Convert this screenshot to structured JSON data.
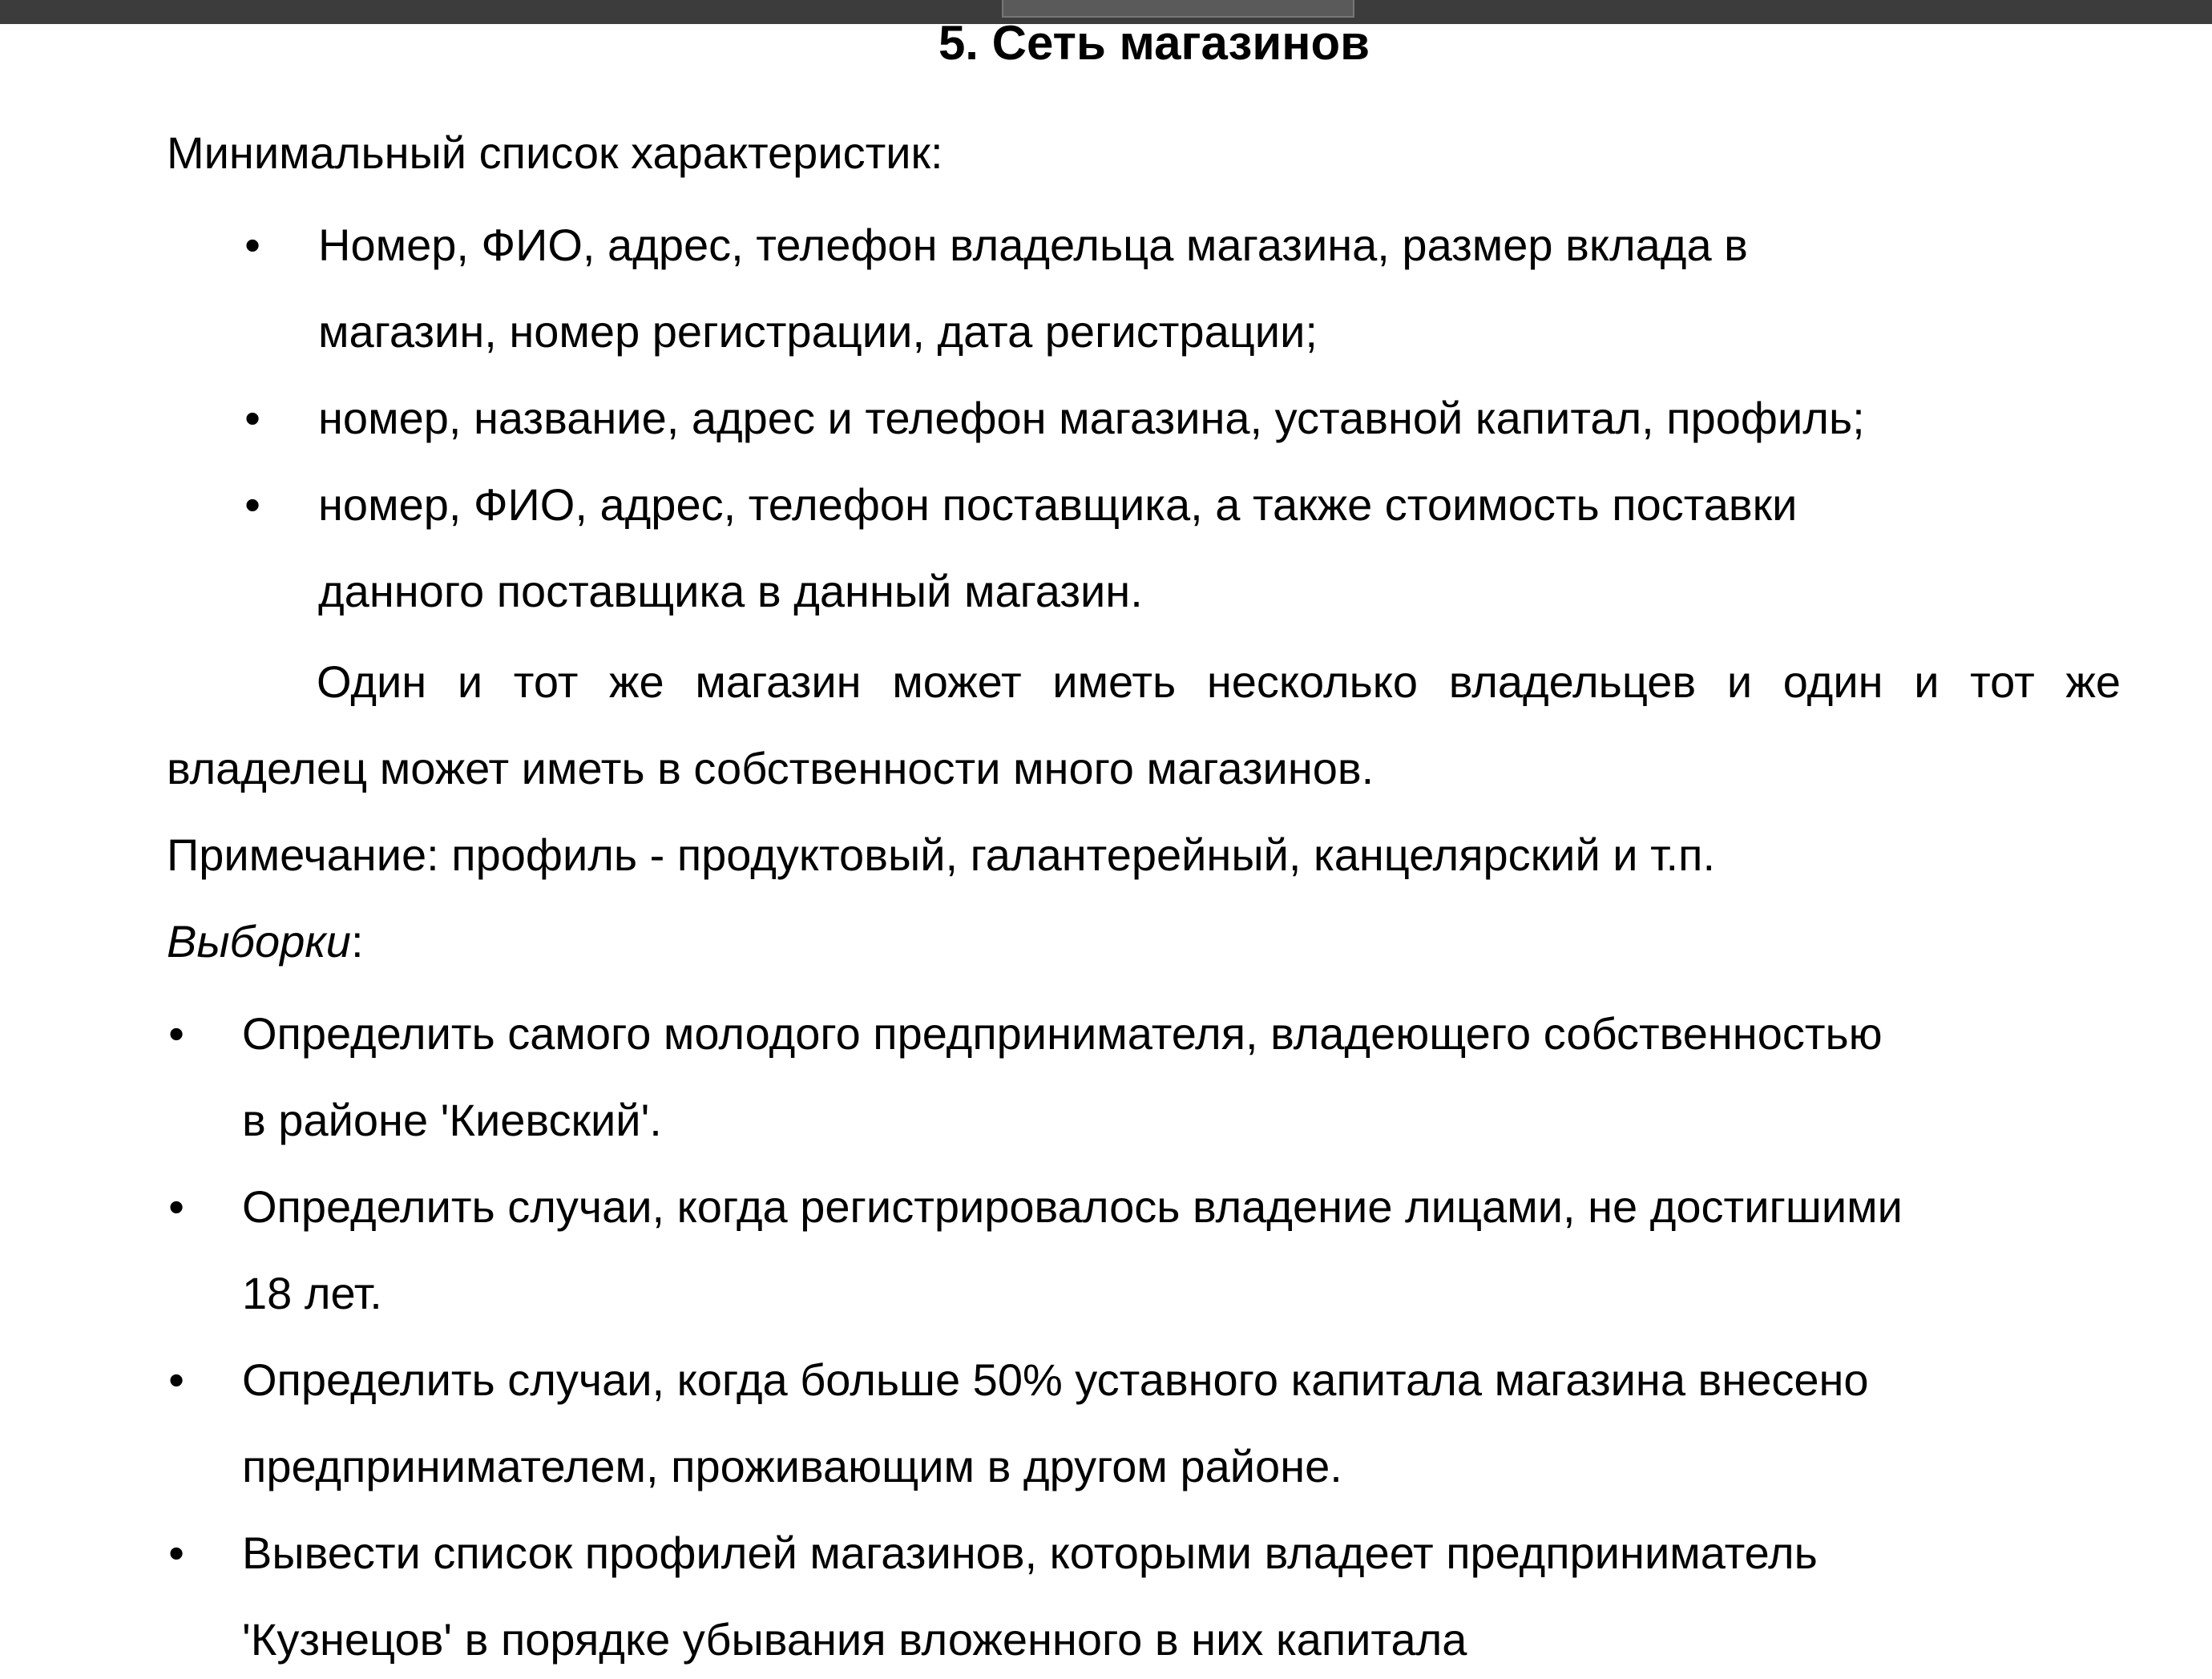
{
  "document": {
    "title": "5. Сеть магазинов",
    "intro": "Минимальный список характеристик:",
    "characteristics": [
      {
        "lines": [
          "Номер, ФИО, адрес, телефон  владельца магазина, размер вклада в",
          "магазин, номер регистрации, дата регистрации;"
        ]
      },
      {
        "lines": [
          "номер, название, адрес и телефон магазина, уставной капитал, профиль;"
        ]
      },
      {
        "lines": [
          "номер, ФИО, адрес, телефон поставщика, а также стоимость поставки",
          "данного поставщика в данный магазин."
        ]
      }
    ],
    "ownership_line1": "Один и тот же магазин может иметь несколько владельцев и один и тот же",
    "ownership_line2": "владелец может иметь в собственности много магазинов.",
    "note": "Примечание: профиль - продуктовый, галантерейный, канцелярский и т.п.",
    "queries_label": "Выборки",
    "queries_colon": ":",
    "queries": [
      {
        "lines": [
          "Определить самого молодого предпринимателя, владеющего собственностью",
          "в районе 'Киевский'."
        ]
      },
      {
        "lines": [
          "Определить случаи, когда регистрировалось владение лицами, не достигшими",
          "18 лет."
        ]
      },
      {
        "lines": [
          "Определить случаи, когда больше 50% уставного капитала магазина внесено",
          "предпринимателем, проживающим в другом районе."
        ]
      },
      {
        "lines": [
          "Вывести список профилей магазинов, которыми владеет предприниматель",
          "'Кузнецов' в порядке убывания вложенного в них капитала"
        ]
      }
    ],
    "bullet_glyph": "•"
  }
}
